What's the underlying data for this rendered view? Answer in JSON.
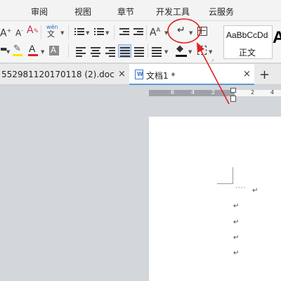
{
  "menu": {
    "items": [
      "审阅",
      "视图",
      "章节",
      "开发工具",
      "云服务"
    ]
  },
  "ribbon": {
    "font_color_letter": "A",
    "highlight_letter": "A",
    "phonetic_top": "wén",
    "phonetic_bottom": "文",
    "grow_font_letter": "A",
    "para_mark_symbol": "↵",
    "style_sample": "AaBbCcDd",
    "style_name": "正文",
    "next_style_letter": "A"
  },
  "tabs": {
    "doc_tab_label": "552981120170118 (2).doc",
    "active_tab_label": "文档1 *",
    "close_symbol": "×",
    "new_tab_symbol": "+"
  },
  "ruler": {
    "left_labels": [
      "6",
      "4",
      "2"
    ],
    "right_labels": [
      "2",
      "4"
    ]
  },
  "document": {
    "dots": "····",
    "paragraph_mark": "↵"
  },
  "colors": {
    "annotation_red": "#e02020",
    "active_tab_accent": "#5b9bd5",
    "font_color_bar": "#e02020",
    "highlight_bar": "#f7e600"
  }
}
